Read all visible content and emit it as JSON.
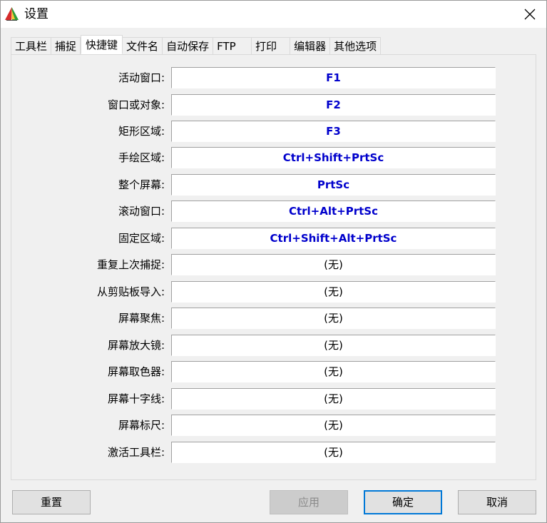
{
  "window": {
    "title": "设置",
    "icon": "app-logo-icon",
    "close_icon": "close-icon"
  },
  "tabs": [
    {
      "label": "工具栏",
      "active": false
    },
    {
      "label": "捕捉",
      "active": false
    },
    {
      "label": "快捷键",
      "active": true
    },
    {
      "label": "文件名",
      "active": false
    },
    {
      "label": "自动保存",
      "active": false
    },
    {
      "label": "FTP",
      "active": false
    },
    {
      "label": "打印",
      "active": false
    },
    {
      "label": "编辑器",
      "active": false
    },
    {
      "label": "其他选项",
      "active": false
    }
  ],
  "hotkeys": [
    {
      "label": "活动窗口:",
      "value": "F1",
      "set": true
    },
    {
      "label": "窗口或对象:",
      "value": "F2",
      "set": true
    },
    {
      "label": "矩形区域:",
      "value": "F3",
      "set": true
    },
    {
      "label": "手绘区域:",
      "value": "Ctrl+Shift+PrtSc",
      "set": true
    },
    {
      "label": "整个屏幕:",
      "value": "PrtSc",
      "set": true
    },
    {
      "label": "滚动窗口:",
      "value": "Ctrl+Alt+PrtSc",
      "set": true
    },
    {
      "label": "固定区域:",
      "value": "Ctrl+Shift+Alt+PrtSc",
      "set": true
    },
    {
      "label": "重复上次捕捉:",
      "value": "(无)",
      "set": false
    },
    {
      "label": "从剪贴板导入:",
      "value": "(无)",
      "set": false
    },
    {
      "label": "屏幕聚焦:",
      "value": "(无)",
      "set": false
    },
    {
      "label": "屏幕放大镜:",
      "value": "(无)",
      "set": false
    },
    {
      "label": "屏幕取色器:",
      "value": "(无)",
      "set": false
    },
    {
      "label": "屏幕十字线:",
      "value": "(无)",
      "set": false
    },
    {
      "label": "屏幕标尺:",
      "value": "(无)",
      "set": false
    },
    {
      "label": "激活工具栏:",
      "value": "(无)",
      "set": false
    }
  ],
  "buttons": {
    "reset": "重置",
    "apply": "应用",
    "ok": "确定",
    "cancel": "取消"
  },
  "colors": {
    "hotkey_set": "#0000cc",
    "default_button_border": "#0078d7"
  }
}
